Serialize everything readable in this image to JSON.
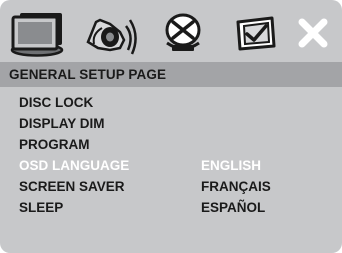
{
  "tabs": [
    {
      "id": "general",
      "icon": "tv-monitor-icon"
    },
    {
      "id": "audio",
      "icon": "speaker-icon"
    },
    {
      "id": "dolby",
      "icon": "dolby-disc-icon"
    },
    {
      "id": "preference",
      "icon": "preference-check-icon"
    },
    {
      "id": "exit",
      "icon": "close-icon"
    }
  ],
  "header": {
    "title": "GENERAL SETUP PAGE"
  },
  "menu": {
    "items": [
      "DISC LOCK",
      "DISPLAY DIM",
      "PROGRAM",
      "OSD LANGUAGE",
      "SCREEN SAVER",
      "SLEEP"
    ],
    "selected": "OSD LANGUAGE"
  },
  "options": {
    "items": [
      "ENGLISH",
      "FRANÇAIS",
      "ESPAÑOL"
    ],
    "selected": "ENGLISH"
  },
  "colors": {
    "panel": "#c7c8ca",
    "header": "#a3a4a7",
    "text": "#1a1a1a",
    "highlight": "#ffffff",
    "icon": "#1a1a1a",
    "icon_fill": "#7d7f82"
  }
}
